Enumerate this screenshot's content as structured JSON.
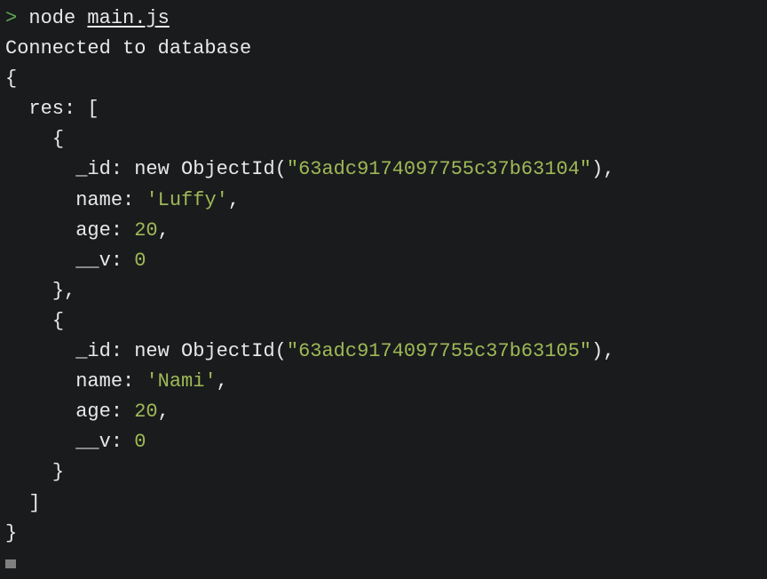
{
  "terminal": {
    "prompt_symbol": ">",
    "command": "node",
    "command_arg": "main.js",
    "connected_msg": "Connected to database",
    "punct": {
      "open_brace": "{",
      "close_brace": "}",
      "open_bracket": "[",
      "close_bracket": "]",
      "colon": ":",
      "comma": ",",
      "paren_open": "(",
      "paren_close": ")"
    },
    "keys": {
      "res": "res",
      "id": "_id",
      "name": "name",
      "age": "age",
      "v": "__v"
    },
    "keywords": {
      "new": "new",
      "ObjectId": "ObjectId"
    },
    "records": [
      {
        "id_str": "\"63adc9174097755c37b63104\"",
        "name_str": "'Luffy'",
        "age_val": "20",
        "v_val": "0"
      },
      {
        "id_str": "\"63adc9174097755c37b63105\"",
        "name_str": "'Nami'",
        "age_val": "20",
        "v_val": "0"
      }
    ]
  }
}
